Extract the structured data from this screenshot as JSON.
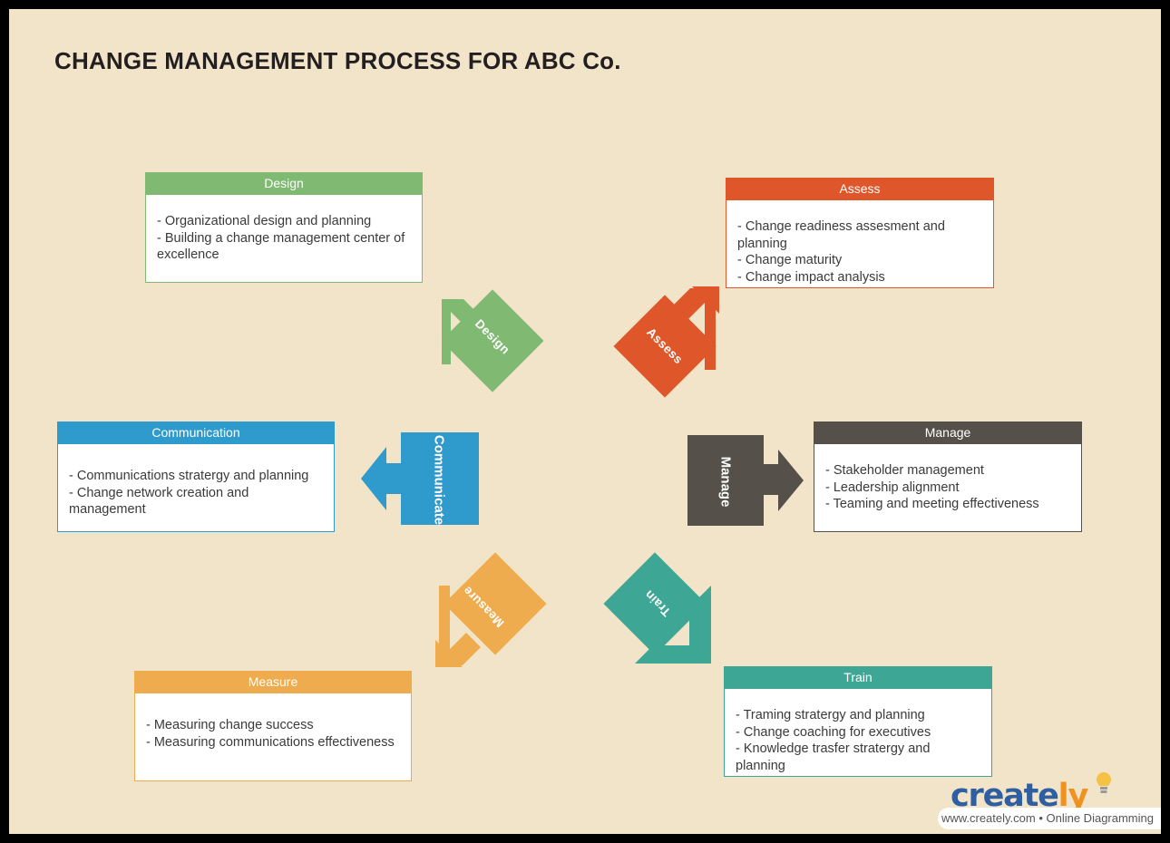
{
  "page": {
    "title": "CHANGE MANAGEMENT PROCESS FOR ABC Co.",
    "background_color": "#F2E4C8",
    "frame_color": "#000000"
  },
  "cards": [
    {
      "id": "design",
      "title": "Design",
      "color": "#7FB972",
      "lines": [
        "- Organizational design and planning",
        "- Building a change management center of",
        "excellence"
      ]
    },
    {
      "id": "assess",
      "title": "Assess",
      "color": "#E0562B",
      "lines": [
        "- Change readiness assesment and planning",
        "- Change maturity",
        "- Change impact analysis"
      ]
    },
    {
      "id": "communication",
      "title": "Communication",
      "color": "#2E9BCC",
      "lines": [
        "- Communications stratergy and planning",
        "- Change network creation and management"
      ]
    },
    {
      "id": "manage",
      "title": "Manage",
      "color": "#55504A",
      "lines": [
        "- Stakeholder management",
        "- Leadership alignment",
        "- Teaming and meeting effectiveness"
      ]
    },
    {
      "id": "measure",
      "title": "Measure",
      "color": "#EFAC4E",
      "lines": [
        "- Measuring change success",
        "- Measuring communications effectiveness"
      ]
    },
    {
      "id": "train",
      "title": "Train",
      "color": "#3DA694",
      "lines": [
        "- Traming stratergy and planning",
        "- Change coaching for executives",
        "- Knowledge trasfer stratergy and planning"
      ]
    }
  ],
  "arrows": [
    {
      "id": "design",
      "label": "Design",
      "color": "#7FB972",
      "direction": "up-left"
    },
    {
      "id": "assess",
      "label": "Assess",
      "color": "#E0562B",
      "direction": "up-right"
    },
    {
      "id": "communicate",
      "label": "Communicate",
      "color": "#2E9BCC",
      "direction": "left"
    },
    {
      "id": "manage",
      "label": "Manage",
      "color": "#55504A",
      "direction": "right"
    },
    {
      "id": "measure",
      "label": "Measure",
      "color": "#EFAC4E",
      "direction": "down-left"
    },
    {
      "id": "train",
      "label": "Train",
      "color": "#3DA694",
      "direction": "down-right"
    }
  ],
  "logo": {
    "name_part1": "creat",
    "name_part2": "e",
    "name_part3": "ly",
    "tagline": "www.creately.com • Online Diagramming",
    "blue": "#2E5FA3",
    "orange": "#F0921F"
  }
}
